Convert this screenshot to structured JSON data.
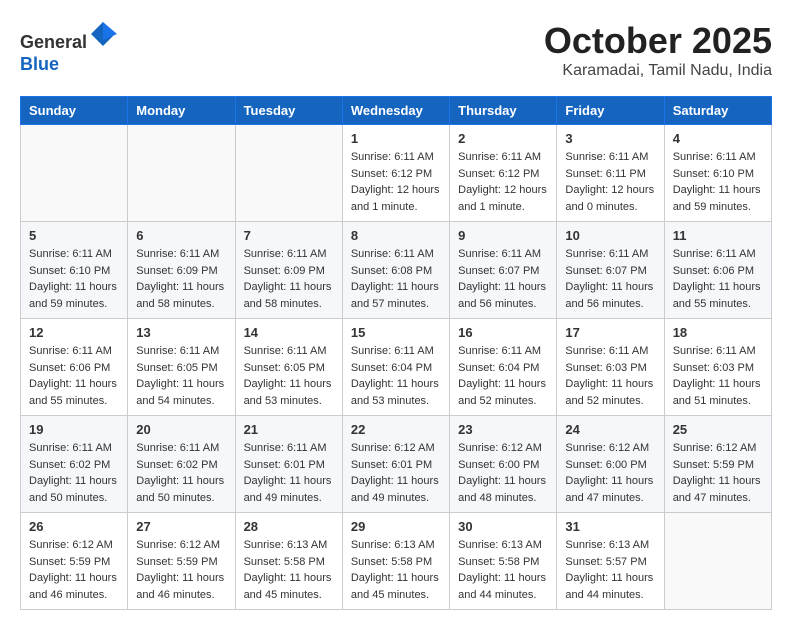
{
  "header": {
    "logo_line1": "General",
    "logo_line2": "Blue",
    "month": "October 2025",
    "location": "Karamadai, Tamil Nadu, India"
  },
  "weekdays": [
    "Sunday",
    "Monday",
    "Tuesday",
    "Wednesday",
    "Thursday",
    "Friday",
    "Saturday"
  ],
  "weeks": [
    [
      {
        "day": "",
        "info": ""
      },
      {
        "day": "",
        "info": ""
      },
      {
        "day": "",
        "info": ""
      },
      {
        "day": "1",
        "info": "Sunrise: 6:11 AM\nSunset: 6:12 PM\nDaylight: 12 hours\nand 1 minute."
      },
      {
        "day": "2",
        "info": "Sunrise: 6:11 AM\nSunset: 6:12 PM\nDaylight: 12 hours\nand 1 minute."
      },
      {
        "day": "3",
        "info": "Sunrise: 6:11 AM\nSunset: 6:11 PM\nDaylight: 12 hours\nand 0 minutes."
      },
      {
        "day": "4",
        "info": "Sunrise: 6:11 AM\nSunset: 6:10 PM\nDaylight: 11 hours\nand 59 minutes."
      }
    ],
    [
      {
        "day": "5",
        "info": "Sunrise: 6:11 AM\nSunset: 6:10 PM\nDaylight: 11 hours\nand 59 minutes."
      },
      {
        "day": "6",
        "info": "Sunrise: 6:11 AM\nSunset: 6:09 PM\nDaylight: 11 hours\nand 58 minutes."
      },
      {
        "day": "7",
        "info": "Sunrise: 6:11 AM\nSunset: 6:09 PM\nDaylight: 11 hours\nand 58 minutes."
      },
      {
        "day": "8",
        "info": "Sunrise: 6:11 AM\nSunset: 6:08 PM\nDaylight: 11 hours\nand 57 minutes."
      },
      {
        "day": "9",
        "info": "Sunrise: 6:11 AM\nSunset: 6:07 PM\nDaylight: 11 hours\nand 56 minutes."
      },
      {
        "day": "10",
        "info": "Sunrise: 6:11 AM\nSunset: 6:07 PM\nDaylight: 11 hours\nand 56 minutes."
      },
      {
        "day": "11",
        "info": "Sunrise: 6:11 AM\nSunset: 6:06 PM\nDaylight: 11 hours\nand 55 minutes."
      }
    ],
    [
      {
        "day": "12",
        "info": "Sunrise: 6:11 AM\nSunset: 6:06 PM\nDaylight: 11 hours\nand 55 minutes."
      },
      {
        "day": "13",
        "info": "Sunrise: 6:11 AM\nSunset: 6:05 PM\nDaylight: 11 hours\nand 54 minutes."
      },
      {
        "day": "14",
        "info": "Sunrise: 6:11 AM\nSunset: 6:05 PM\nDaylight: 11 hours\nand 53 minutes."
      },
      {
        "day": "15",
        "info": "Sunrise: 6:11 AM\nSunset: 6:04 PM\nDaylight: 11 hours\nand 53 minutes."
      },
      {
        "day": "16",
        "info": "Sunrise: 6:11 AM\nSunset: 6:04 PM\nDaylight: 11 hours\nand 52 minutes."
      },
      {
        "day": "17",
        "info": "Sunrise: 6:11 AM\nSunset: 6:03 PM\nDaylight: 11 hours\nand 52 minutes."
      },
      {
        "day": "18",
        "info": "Sunrise: 6:11 AM\nSunset: 6:03 PM\nDaylight: 11 hours\nand 51 minutes."
      }
    ],
    [
      {
        "day": "19",
        "info": "Sunrise: 6:11 AM\nSunset: 6:02 PM\nDaylight: 11 hours\nand 50 minutes."
      },
      {
        "day": "20",
        "info": "Sunrise: 6:11 AM\nSunset: 6:02 PM\nDaylight: 11 hours\nand 50 minutes."
      },
      {
        "day": "21",
        "info": "Sunrise: 6:11 AM\nSunset: 6:01 PM\nDaylight: 11 hours\nand 49 minutes."
      },
      {
        "day": "22",
        "info": "Sunrise: 6:12 AM\nSunset: 6:01 PM\nDaylight: 11 hours\nand 49 minutes."
      },
      {
        "day": "23",
        "info": "Sunrise: 6:12 AM\nSunset: 6:00 PM\nDaylight: 11 hours\nand 48 minutes."
      },
      {
        "day": "24",
        "info": "Sunrise: 6:12 AM\nSunset: 6:00 PM\nDaylight: 11 hours\nand 47 minutes."
      },
      {
        "day": "25",
        "info": "Sunrise: 6:12 AM\nSunset: 5:59 PM\nDaylight: 11 hours\nand 47 minutes."
      }
    ],
    [
      {
        "day": "26",
        "info": "Sunrise: 6:12 AM\nSunset: 5:59 PM\nDaylight: 11 hours\nand 46 minutes."
      },
      {
        "day": "27",
        "info": "Sunrise: 6:12 AM\nSunset: 5:59 PM\nDaylight: 11 hours\nand 46 minutes."
      },
      {
        "day": "28",
        "info": "Sunrise: 6:13 AM\nSunset: 5:58 PM\nDaylight: 11 hours\nand 45 minutes."
      },
      {
        "day": "29",
        "info": "Sunrise: 6:13 AM\nSunset: 5:58 PM\nDaylight: 11 hours\nand 45 minutes."
      },
      {
        "day": "30",
        "info": "Sunrise: 6:13 AM\nSunset: 5:58 PM\nDaylight: 11 hours\nand 44 minutes."
      },
      {
        "day": "31",
        "info": "Sunrise: 6:13 AM\nSunset: 5:57 PM\nDaylight: 11 hours\nand 44 minutes."
      },
      {
        "day": "",
        "info": ""
      }
    ]
  ]
}
